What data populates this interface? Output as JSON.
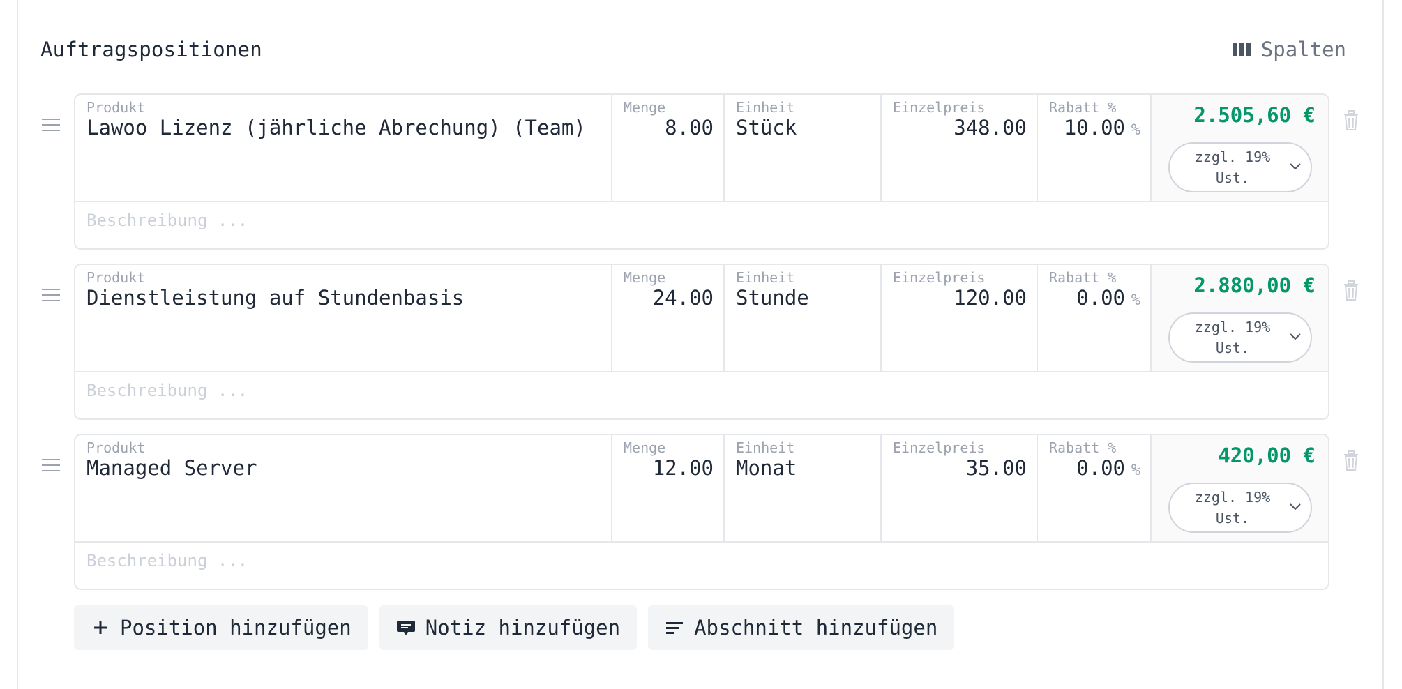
{
  "header": {
    "title": "Auftragspositionen",
    "columns_label": "Spalten",
    "columns_icon": "columns-icon"
  },
  "column_labels": {
    "product": "Produkt",
    "quantity": "Menge",
    "unit": "Einheit",
    "unit_price": "Einzelpreis",
    "discount": "Rabatt %"
  },
  "percent_symbol": "%",
  "description_placeholder": "Beschreibung ...",
  "items": [
    {
      "product": "Lawoo Lizenz (jährliche Abrechung) (Team)",
      "quantity": "8.00",
      "unit": "Stück",
      "unit_price": "348.00",
      "discount": "10.00",
      "total": "2.505,60 €",
      "tax_line1": "zzgl. 19%",
      "tax_line2": "Ust."
    },
    {
      "product": "Dienstleistung auf Stundenbasis",
      "quantity": "24.00",
      "unit": "Stunde",
      "unit_price": "120.00",
      "discount": "0.00",
      "total": "2.880,00 €",
      "tax_line1": "zzgl. 19%",
      "tax_line2": "Ust."
    },
    {
      "product": "Managed Server",
      "quantity": "12.00",
      "unit": "Monat",
      "unit_price": "35.00",
      "discount": "0.00",
      "total": "420,00 €",
      "tax_line1": "zzgl. 19%",
      "tax_line2": "Ust."
    }
  ],
  "actions": {
    "add_position": "Position hinzufügen",
    "add_note": "Notiz hinzufügen",
    "add_section": "Abschnitt hinzufügen"
  },
  "colors": {
    "total_green": "#059669",
    "border": "#e5e7eb",
    "button_bg": "#f3f4f6"
  }
}
